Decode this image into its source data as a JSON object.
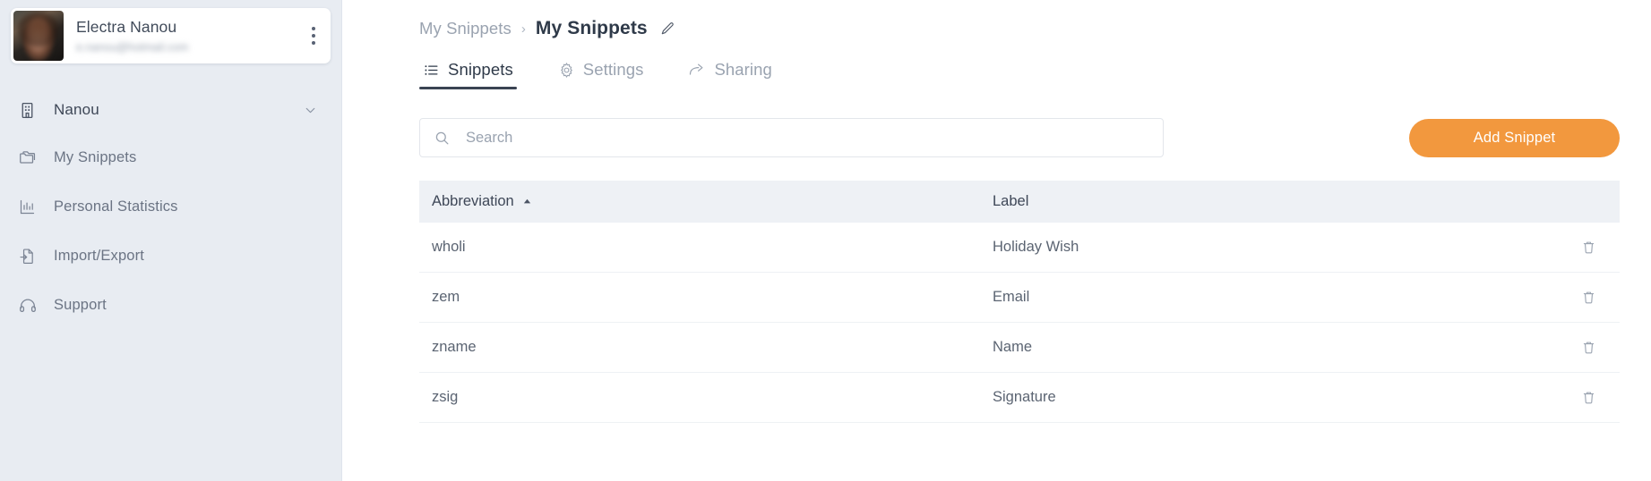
{
  "sidebar": {
    "user": {
      "name": "Electra Nanou",
      "email": "e.nanou@hotmail.com",
      "menu_icon": "kebab-menu-icon",
      "avatar": "user-avatar"
    },
    "org": {
      "label": "Nanou",
      "icon": "building-icon",
      "chevron": "chevron-down-icon"
    },
    "items": [
      {
        "label": "My Snippets",
        "icon": "folder-icon"
      },
      {
        "label": "Personal Statistics",
        "icon": "bar-chart-icon"
      },
      {
        "label": "Import/Export",
        "icon": "file-import-export-icon"
      },
      {
        "label": "Support",
        "icon": "headset-icon"
      }
    ]
  },
  "breadcrumb": {
    "parent": "My Snippets",
    "separator": "›",
    "current": "My Snippets",
    "edit_icon": "pencil-icon"
  },
  "tabs": [
    {
      "label": "Snippets",
      "icon": "list-icon",
      "active": true
    },
    {
      "label": "Settings",
      "icon": "gear-icon",
      "active": false
    },
    {
      "label": "Sharing",
      "icon": "share-arrow-icon",
      "active": false
    }
  ],
  "toolbar": {
    "search_placeholder": "Search",
    "search_value": "",
    "search_icon": "search-icon",
    "add_label": "Add Snippet",
    "add_color": "#f2983e"
  },
  "table": {
    "columns": [
      {
        "label": "Abbreviation",
        "sort": "asc"
      },
      {
        "label": "Label"
      }
    ],
    "rows": [
      {
        "abbreviation": "wholi",
        "label": "Holiday Wish",
        "delete_icon": "trash-icon"
      },
      {
        "abbreviation": "zem",
        "label": "Email",
        "delete_icon": "trash-icon"
      },
      {
        "abbreviation": "zname",
        "label": "Name",
        "delete_icon": "trash-icon"
      },
      {
        "abbreviation": "zsig",
        "label": "Signature",
        "delete_icon": "trash-icon"
      }
    ]
  },
  "colors": {
    "sidebar_bg": "#e8ecf2",
    "accent": "#f2983e",
    "header_bg": "#eef1f5",
    "text_dark": "#2f3a49",
    "text_muted": "#9aa3b0"
  }
}
